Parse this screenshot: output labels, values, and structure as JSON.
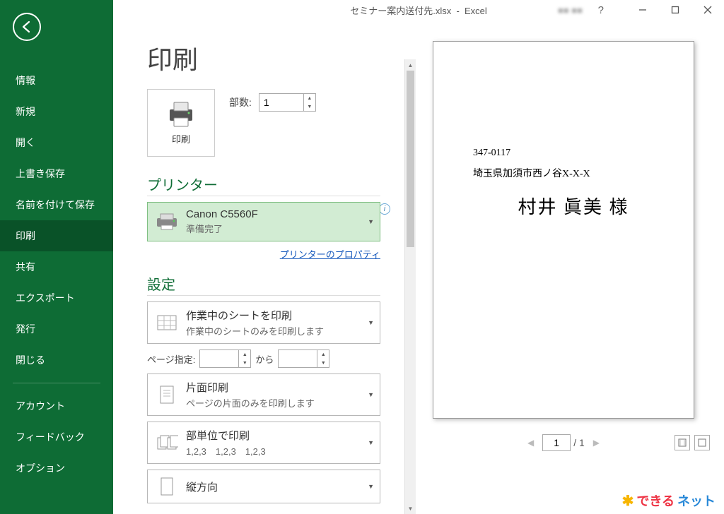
{
  "titlebar": {
    "filename": "セミナー案内送付先.xlsx",
    "app": "Excel",
    "user": "■■ ■■",
    "help": "?"
  },
  "sidebar": {
    "items": [
      "情報",
      "新規",
      "開く",
      "上書き保存",
      "名前を付けて保存",
      "印刷",
      "共有",
      "エクスポート",
      "発行",
      "閉じる"
    ],
    "extra": [
      "アカウント",
      "フィードバック",
      "オプション"
    ],
    "active_index": 5
  },
  "page": {
    "title": "印刷",
    "print_button": "印刷",
    "copies_label": "部数:",
    "copies_value": "1",
    "printer_section": "プリンター",
    "printer_name": "Canon C5560F",
    "printer_status": "準備完了",
    "printer_props": "プリンターのプロパティ",
    "settings_section": "設定",
    "settings": [
      {
        "line1": "作業中のシートを印刷",
        "line2": "作業中のシートのみを印刷します",
        "icon": "sheet"
      },
      {
        "line1": "片面印刷",
        "line2": "ページの片面のみを印刷します",
        "icon": "singleside"
      },
      {
        "line1": "部単位で印刷",
        "line2": "1,2,3　1,2,3　1,2,3",
        "icon": "collate"
      },
      {
        "line1": "縦方向",
        "line2": "",
        "icon": "portrait"
      }
    ],
    "page_range_label": "ページ指定:",
    "page_range_from": "",
    "page_range_to_label": "から",
    "page_range_to": ""
  },
  "preview": {
    "postal": "347-0117",
    "address": "埼玉県加須市西ノ谷X-X-X",
    "name": "村井 眞美  様",
    "current_page": "1",
    "total_pages": "/ 1"
  },
  "watermark": {
    "t1": "できる",
    "t2": "ネット"
  }
}
